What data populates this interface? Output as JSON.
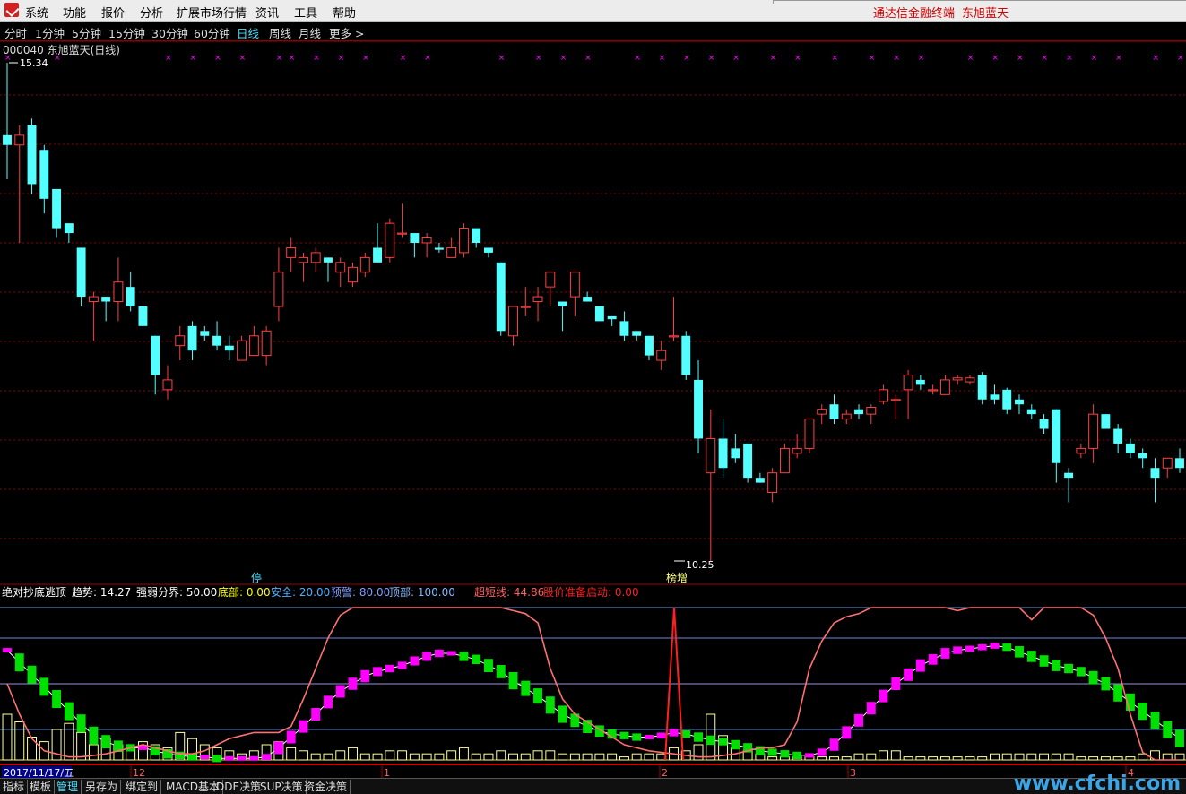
{
  "menu": [
    "系统",
    "功能",
    "报价",
    "分析",
    "扩展市场行情",
    "资讯",
    "工具",
    "帮助"
  ],
  "brand": "通达信金融终端",
  "stock_name_header": "东旭蓝天",
  "periods": [
    "分时",
    "1分钟",
    "5分钟",
    "15分钟",
    "30分钟",
    "60分钟",
    "日线",
    "周线",
    "月线",
    "更多 >"
  ],
  "active_period": "日线",
  "main_title": "000040 东旭蓝天(日线)",
  "price_high_label": "15.34",
  "price_low_label": "10.25",
  "marker_ting": "停",
  "marker_bangzeng": "榜增",
  "indicator": {
    "name": "绝对抄底逃顶",
    "items": [
      {
        "label": "趋势:",
        "value": "14.27",
        "color": "#ffffff"
      },
      {
        "label": "强弱分界:",
        "value": "50.00",
        "color": "#ffffff"
      },
      {
        "label": "底部:",
        "value": "0.00",
        "color": "#ffff00"
      },
      {
        "label": "安全:",
        "value": "20.00",
        "color": "#4fb0ff"
      },
      {
        "label": "预警:",
        "value": "80.00",
        "color": "#7f9fff"
      },
      {
        "label": "顶部:",
        "value": "100.00",
        "color": "#7fb8ff"
      },
      {
        "label": "超短线:",
        "value": "44.86",
        "color": "#ff6060"
      },
      {
        "label": "股价准备启动:",
        "value": "0.00",
        "color": "#ff2020"
      }
    ]
  },
  "date_axis": {
    "cursor_date": "2017/11/17/五",
    "labels": [
      "12",
      "1",
      "2",
      "3",
      "4"
    ]
  },
  "footer_tabs": [
    "指标",
    "模板",
    "管理",
    "另存为",
    "绑定到",
    "MACD基本",
    "DDE决策",
    "SUP决策",
    "资金决策"
  ],
  "footer_active": "管理",
  "watermark": "www.cfchi.com",
  "colors": {
    "up": "#ff4040",
    "down": "#54ffff",
    "grid": "#8b0000",
    "magenta": "#ff00ff",
    "green": "#00e000",
    "yellow_bar": "#ffffa0",
    "short_line": "#ff7070"
  },
  "chart_data": {
    "type": "candlestick",
    "ylim": [
      10.25,
      15.34
    ],
    "candles": [
      {
        "o": 14.6,
        "h": 15.34,
        "l": 14.15,
        "c": 14.5
      },
      {
        "o": 14.5,
        "h": 14.7,
        "l": 13.5,
        "c": 14.6
      },
      {
        "o": 14.7,
        "h": 14.77,
        "l": 14.0,
        "c": 14.1
      },
      {
        "o": 14.45,
        "h": 14.5,
        "l": 13.8,
        "c": 13.95
      },
      {
        "o": 14.05,
        "h": 14.05,
        "l": 13.55,
        "c": 13.65
      },
      {
        "o": 13.7,
        "h": 13.7,
        "l": 13.5,
        "c": 13.6
      },
      {
        "o": 13.45,
        "h": 13.45,
        "l": 12.85,
        "c": 12.95
      },
      {
        "o": 12.9,
        "h": 13.0,
        "l": 12.5,
        "c": 12.95
      },
      {
        "o": 12.95,
        "h": 12.95,
        "l": 12.7,
        "c": 12.9
      },
      {
        "o": 12.9,
        "h": 13.35,
        "l": 12.7,
        "c": 13.1
      },
      {
        "o": 13.05,
        "h": 13.2,
        "l": 12.8,
        "c": 12.85
      },
      {
        "o": 12.85,
        "h": 12.85,
        "l": 12.65,
        "c": 12.65
      },
      {
        "o": 12.55,
        "h": 12.55,
        "l": 11.95,
        "c": 12.15
      },
      {
        "o": 12.0,
        "h": 12.25,
        "l": 11.9,
        "c": 12.1
      },
      {
        "o": 12.45,
        "h": 12.65,
        "l": 12.3,
        "c": 12.55
      },
      {
        "o": 12.65,
        "h": 12.7,
        "l": 12.3,
        "c": 12.4
      },
      {
        "o": 12.6,
        "h": 12.65,
        "l": 12.5,
        "c": 12.55
      },
      {
        "o": 12.55,
        "h": 12.7,
        "l": 12.4,
        "c": 12.45
      },
      {
        "o": 12.45,
        "h": 12.55,
        "l": 12.3,
        "c": 12.4
      },
      {
        "o": 12.3,
        "h": 12.55,
        "l": 12.3,
        "c": 12.5
      },
      {
        "o": 12.35,
        "h": 12.65,
        "l": 12.35,
        "c": 12.55
      },
      {
        "o": 12.35,
        "h": 12.65,
        "l": 12.25,
        "c": 12.6
      },
      {
        "o": 12.85,
        "h": 13.45,
        "l": 12.7,
        "c": 13.2
      },
      {
        "o": 13.35,
        "h": 13.55,
        "l": 13.2,
        "c": 13.45
      },
      {
        "o": 13.3,
        "h": 13.4,
        "l": 13.1,
        "c": 13.35
      },
      {
        "o": 13.3,
        "h": 13.45,
        "l": 13.2,
        "c": 13.4
      },
      {
        "o": 13.35,
        "h": 13.35,
        "l": 13.1,
        "c": 13.3
      },
      {
        "o": 13.2,
        "h": 13.35,
        "l": 13.05,
        "c": 13.3
      },
      {
        "o": 13.1,
        "h": 13.3,
        "l": 13.05,
        "c": 13.25
      },
      {
        "o": 13.2,
        "h": 13.4,
        "l": 13.15,
        "c": 13.35
      },
      {
        "o": 13.45,
        "h": 13.7,
        "l": 13.3,
        "c": 13.3
      },
      {
        "o": 13.35,
        "h": 13.75,
        "l": 13.3,
        "c": 13.7
      },
      {
        "o": 13.6,
        "h": 13.9,
        "l": 13.55,
        "c": 13.6
      },
      {
        "o": 13.6,
        "h": 13.6,
        "l": 13.35,
        "c": 13.5
      },
      {
        "o": 13.5,
        "h": 13.6,
        "l": 13.35,
        "c": 13.55
      },
      {
        "o": 13.45,
        "h": 13.5,
        "l": 13.4,
        "c": 13.43
      },
      {
        "o": 13.35,
        "h": 13.55,
        "l": 13.35,
        "c": 13.45
      },
      {
        "o": 13.4,
        "h": 13.7,
        "l": 13.35,
        "c": 13.65
      },
      {
        "o": 13.65,
        "h": 13.65,
        "l": 13.45,
        "c": 13.5
      },
      {
        "o": 13.45,
        "h": 13.45,
        "l": 13.35,
        "c": 13.4
      },
      {
        "o": 13.3,
        "h": 13.3,
        "l": 12.55,
        "c": 12.6
      },
      {
        "o": 12.55,
        "h": 12.85,
        "l": 12.45,
        "c": 12.85
      },
      {
        "o": 12.85,
        "h": 13.05,
        "l": 12.75,
        "c": 12.85
      },
      {
        "o": 12.9,
        "h": 13.05,
        "l": 12.7,
        "c": 12.95
      },
      {
        "o": 13.05,
        "h": 13.2,
        "l": 12.85,
        "c": 13.2
      },
      {
        "o": 12.9,
        "h": 12.9,
        "l": 12.6,
        "c": 12.85
      },
      {
        "o": 12.95,
        "h": 13.2,
        "l": 12.75,
        "c": 13.2
      },
      {
        "o": 12.95,
        "h": 13.0,
        "l": 12.9,
        "c": 12.9
      },
      {
        "o": 12.85,
        "h": 12.85,
        "l": 12.7,
        "c": 12.7
      },
      {
        "o": 12.75,
        "h": 12.75,
        "l": 12.65,
        "c": 12.72
      },
      {
        "o": 12.7,
        "h": 12.8,
        "l": 12.5,
        "c": 12.55
      },
      {
        "o": 12.6,
        "h": 12.6,
        "l": 12.5,
        "c": 12.55
      },
      {
        "o": 12.55,
        "h": 12.55,
        "l": 12.3,
        "c": 12.35
      },
      {
        "o": 12.3,
        "h": 12.5,
        "l": 12.2,
        "c": 12.4
      },
      {
        "o": 12.55,
        "h": 12.95,
        "l": 12.5,
        "c": 12.55
      },
      {
        "o": 12.55,
        "h": 12.6,
        "l": 12.1,
        "c": 12.15
      },
      {
        "o": 12.1,
        "h": 12.3,
        "l": 11.35,
        "c": 11.5
      },
      {
        "o": 11.15,
        "h": 11.8,
        "l": 10.25,
        "c": 11.5
      },
      {
        "o": 11.5,
        "h": 11.7,
        "l": 11.1,
        "c": 11.2
      },
      {
        "o": 11.4,
        "h": 11.55,
        "l": 11.25,
        "c": 11.3
      },
      {
        "o": 11.45,
        "h": 11.45,
        "l": 11.05,
        "c": 11.1
      },
      {
        "o": 11.1,
        "h": 11.15,
        "l": 11.05,
        "c": 11.05
      },
      {
        "o": 10.95,
        "h": 11.2,
        "l": 10.85,
        "c": 11.15
      },
      {
        "o": 11.15,
        "h": 11.45,
        "l": 11.15,
        "c": 11.4
      },
      {
        "o": 11.35,
        "h": 11.55,
        "l": 11.3,
        "c": 11.4
      },
      {
        "o": 11.4,
        "h": 11.7,
        "l": 11.35,
        "c": 11.7
      },
      {
        "o": 11.75,
        "h": 11.85,
        "l": 11.65,
        "c": 11.8
      },
      {
        "o": 11.85,
        "h": 11.95,
        "l": 11.65,
        "c": 11.7
      },
      {
        "o": 11.7,
        "h": 11.8,
        "l": 11.65,
        "c": 11.75
      },
      {
        "o": 11.8,
        "h": 11.85,
        "l": 11.7,
        "c": 11.75
      },
      {
        "o": 11.75,
        "h": 11.85,
        "l": 11.65,
        "c": 11.82
      },
      {
        "o": 11.88,
        "h": 12.05,
        "l": 11.85,
        "c": 12.0
      },
      {
        "o": 11.9,
        "h": 11.95,
        "l": 11.7,
        "c": 11.9
      },
      {
        "o": 12.0,
        "h": 12.2,
        "l": 11.7,
        "c": 12.15
      },
      {
        "o": 12.1,
        "h": 12.15,
        "l": 12.0,
        "c": 12.05
      },
      {
        "o": 12.0,
        "h": 12.05,
        "l": 11.95,
        "c": 12.0
      },
      {
        "o": 11.95,
        "h": 12.15,
        "l": 11.95,
        "c": 12.1
      },
      {
        "o": 12.1,
        "h": 12.15,
        "l": 12.05,
        "c": 12.12
      },
      {
        "o": 12.08,
        "h": 12.15,
        "l": 12.05,
        "c": 12.12
      },
      {
        "o": 12.15,
        "h": 12.18,
        "l": 11.85,
        "c": 11.9
      },
      {
        "o": 11.95,
        "h": 12.05,
        "l": 11.85,
        "c": 11.9
      },
      {
        "o": 12.0,
        "h": 12.02,
        "l": 11.75,
        "c": 11.8
      },
      {
        "o": 11.9,
        "h": 11.95,
        "l": 11.75,
        "c": 11.85
      },
      {
        "o": 11.8,
        "h": 11.85,
        "l": 11.7,
        "c": 11.75
      },
      {
        "o": 11.7,
        "h": 11.75,
        "l": 11.55,
        "c": 11.6
      },
      {
        "o": 11.8,
        "h": 11.8,
        "l": 11.05,
        "c": 11.25
      },
      {
        "o": 11.15,
        "h": 11.2,
        "l": 10.85,
        "c": 11.1
      },
      {
        "o": 11.35,
        "h": 11.45,
        "l": 11.3,
        "c": 11.4
      },
      {
        "o": 11.4,
        "h": 11.85,
        "l": 11.25,
        "c": 11.75
      },
      {
        "o": 11.75,
        "h": 11.75,
        "l": 11.6,
        "c": 11.6
      },
      {
        "o": 11.6,
        "h": 11.65,
        "l": 11.35,
        "c": 11.45
      },
      {
        "o": 11.45,
        "h": 11.5,
        "l": 11.3,
        "c": 11.35
      },
      {
        "o": 11.35,
        "h": 11.4,
        "l": 11.2,
        "c": 11.3
      },
      {
        "o": 11.2,
        "h": 11.3,
        "l": 10.85,
        "c": 11.1
      },
      {
        "o": 11.2,
        "h": 11.3,
        "l": 11.1,
        "c": 11.3
      },
      {
        "o": 11.3,
        "h": 11.4,
        "l": 11.15,
        "c": 11.2
      }
    ],
    "indicator": {
      "ylim": [
        0,
        100
      ],
      "levels": [
        0,
        20,
        50,
        80,
        100
      ],
      "trend": [
        72,
        64,
        56,
        48,
        40,
        32,
        24,
        16,
        12,
        9,
        8,
        8,
        6,
        4,
        3,
        2,
        2,
        1,
        1,
        1,
        1,
        2,
        8,
        15,
        22,
        30,
        38,
        45,
        50,
        55,
        58,
        60,
        62,
        65,
        68,
        70,
        70,
        68,
        66,
        62,
        58,
        52,
        47,
        42,
        36,
        30,
        26,
        22,
        19,
        17,
        16,
        15,
        15,
        16,
        18,
        17,
        15,
        13,
        12,
        10,
        8,
        6,
        5,
        4,
        3,
        3,
        5,
        10,
        18,
        26,
        34,
        42,
        50,
        56,
        62,
        66,
        70,
        72,
        73,
        74,
        75,
        74,
        71,
        68,
        65,
        62,
        60,
        58,
        54,
        50,
        44,
        38,
        32,
        26,
        20,
        14,
        8,
        4,
        2,
        2,
        6,
        12,
        18,
        24,
        26,
        30
      ],
      "short_line": [
        50,
        30,
        14,
        6,
        4,
        2,
        2,
        3,
        4,
        6,
        8,
        10,
        8,
        6,
        4,
        4,
        6,
        10,
        14,
        16,
        18,
        18,
        18,
        22,
        40,
        60,
        80,
        95,
        100,
        100,
        100,
        100,
        100,
        100,
        100,
        100,
        100,
        100,
        100,
        100,
        100,
        98,
        96,
        90,
        60,
        40,
        30,
        25,
        20,
        15,
        10,
        8,
        6,
        5,
        4,
        3,
        2,
        2,
        3,
        4,
        6,
        8,
        8,
        10,
        25,
        60,
        78,
        90,
        94,
        96,
        100,
        100,
        100,
        100,
        100,
        100,
        100,
        98,
        100,
        100,
        100,
        100,
        100,
        92,
        100,
        100,
        100,
        100,
        95,
        80,
        60,
        30,
        5,
        0,
        0,
        0,
        0,
        22,
        25,
        24,
        22
      ],
      "volume": [
        30,
        25,
        15,
        12,
        20,
        24,
        18,
        10,
        14,
        10,
        8,
        12,
        10,
        8,
        18,
        14,
        10,
        8,
        6,
        4,
        6,
        10,
        12,
        8,
        6,
        4,
        4,
        6,
        8,
        4,
        4,
        6,
        6,
        4,
        4,
        4,
        6,
        8,
        4,
        4,
        6,
        4,
        4,
        6,
        6,
        4,
        4,
        4,
        4,
        4,
        2,
        4,
        4,
        4,
        8,
        6,
        10,
        30,
        16,
        8,
        6,
        4,
        2,
        2,
        2,
        2,
        2,
        2,
        2,
        4,
        4,
        6,
        6,
        2,
        2,
        2,
        2,
        2,
        2,
        2,
        4,
        4,
        4,
        4,
        4,
        4,
        4,
        2,
        2,
        2,
        2,
        2,
        4,
        6,
        4,
        4,
        4,
        4,
        4,
        16,
        18,
        12
      ]
    }
  }
}
